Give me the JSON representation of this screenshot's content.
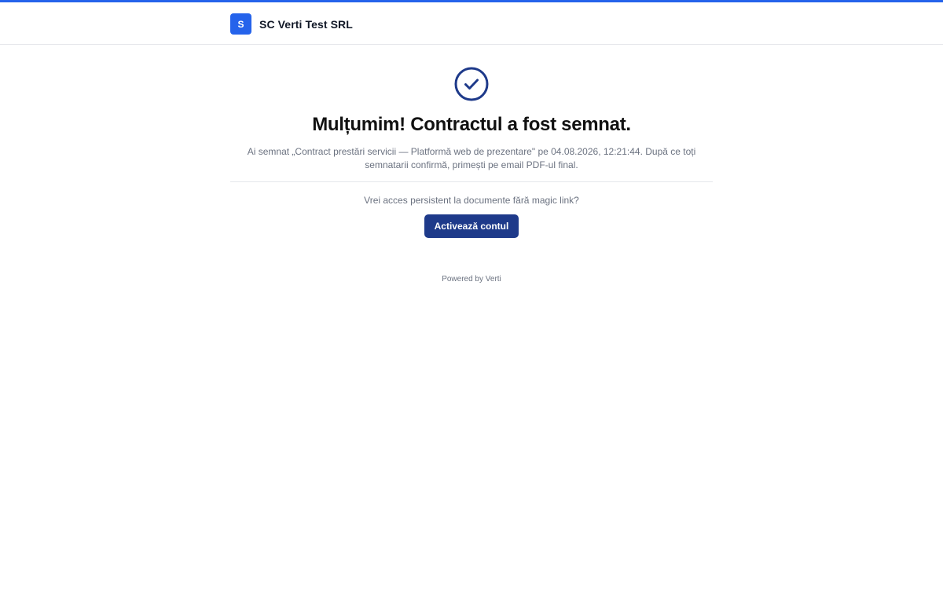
{
  "header": {
    "logo_letter": "S",
    "company_name": "SC Verti Test SRL"
  },
  "main": {
    "icon": "check-circle-icon",
    "title": "Mulțumim! Contractul a fost semnat.",
    "description": "Ai semnat „Contract prestări servicii — Platformă web de prezentare\" pe 04.08.2026, 12:21:44. După ce toți semnatarii confirmă, primești pe email PDF-ul final.",
    "account_prompt": "Vrei acces persistent la documente fără magic link?",
    "activate_label": "Activează contul",
    "powered_by": "Powered by Verti"
  },
  "colors": {
    "accent": "#2563eb",
    "button": "#1e3a8a",
    "check_icon": "#1e3a8a"
  }
}
